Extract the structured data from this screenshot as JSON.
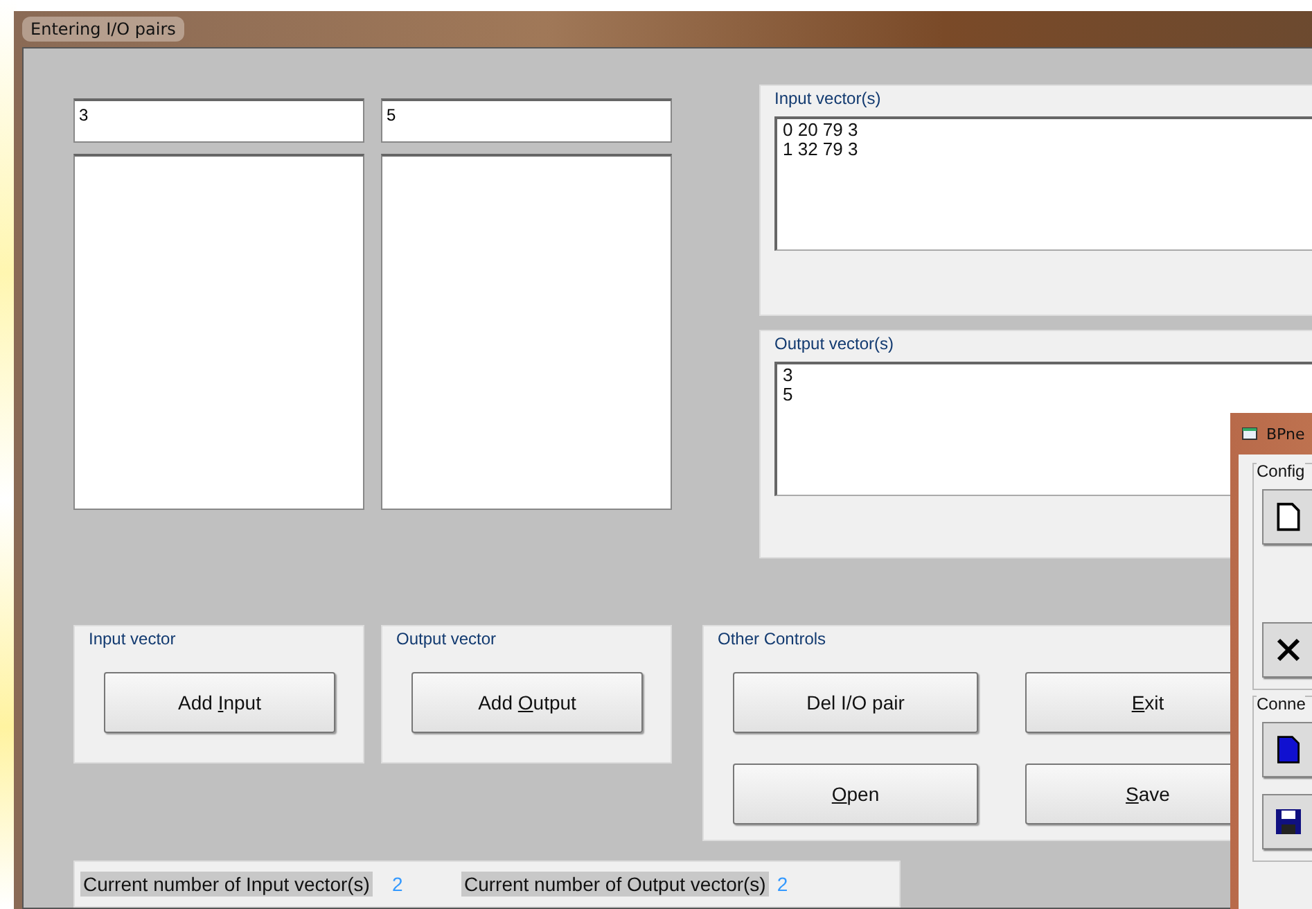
{
  "window": {
    "title": "Entering I/O pairs"
  },
  "input_field": {
    "value": "3"
  },
  "output_field": {
    "value": "5"
  },
  "input_vectors": {
    "label": "Input vector(s)",
    "lines": [
      "0 20 79 3",
      "1 32 79 3"
    ]
  },
  "output_vectors": {
    "label": "Output vector(s)",
    "lines": [
      "3",
      "5"
    ]
  },
  "groups": [
    {
      "label": "Input vector",
      "buttons": [
        {
          "pre": "Add ",
          "key": "I",
          "post": "nput"
        }
      ]
    },
    {
      "label": "Output vector",
      "buttons": [
        {
          "pre": "Add ",
          "key": "O",
          "post": "utput"
        }
      ]
    },
    {
      "label": "Other Controls",
      "buttons": [
        {
          "pre": "Del I/O pair"
        },
        {
          "key": "E",
          "post": "xit"
        },
        {
          "key": "O",
          "post": "pen"
        },
        {
          "key": "S",
          "post": "ave"
        }
      ]
    }
  ],
  "status_bar": [
    {
      "label": "Current number of Input vector(s)",
      "value": "2"
    },
    {
      "label": "Current number of Output vector(s)",
      "value": "2"
    }
  ],
  "second_window": {
    "title": "BPne",
    "groups": [
      {
        "label": "Config",
        "buttons": [
          {
            "kind": "new"
          },
          {
            "kind": "delete"
          }
        ]
      },
      {
        "label": "Conne",
        "buttons": [
          {
            "kind": "blue-new"
          },
          {
            "kind": "save"
          }
        ]
      }
    ]
  }
}
